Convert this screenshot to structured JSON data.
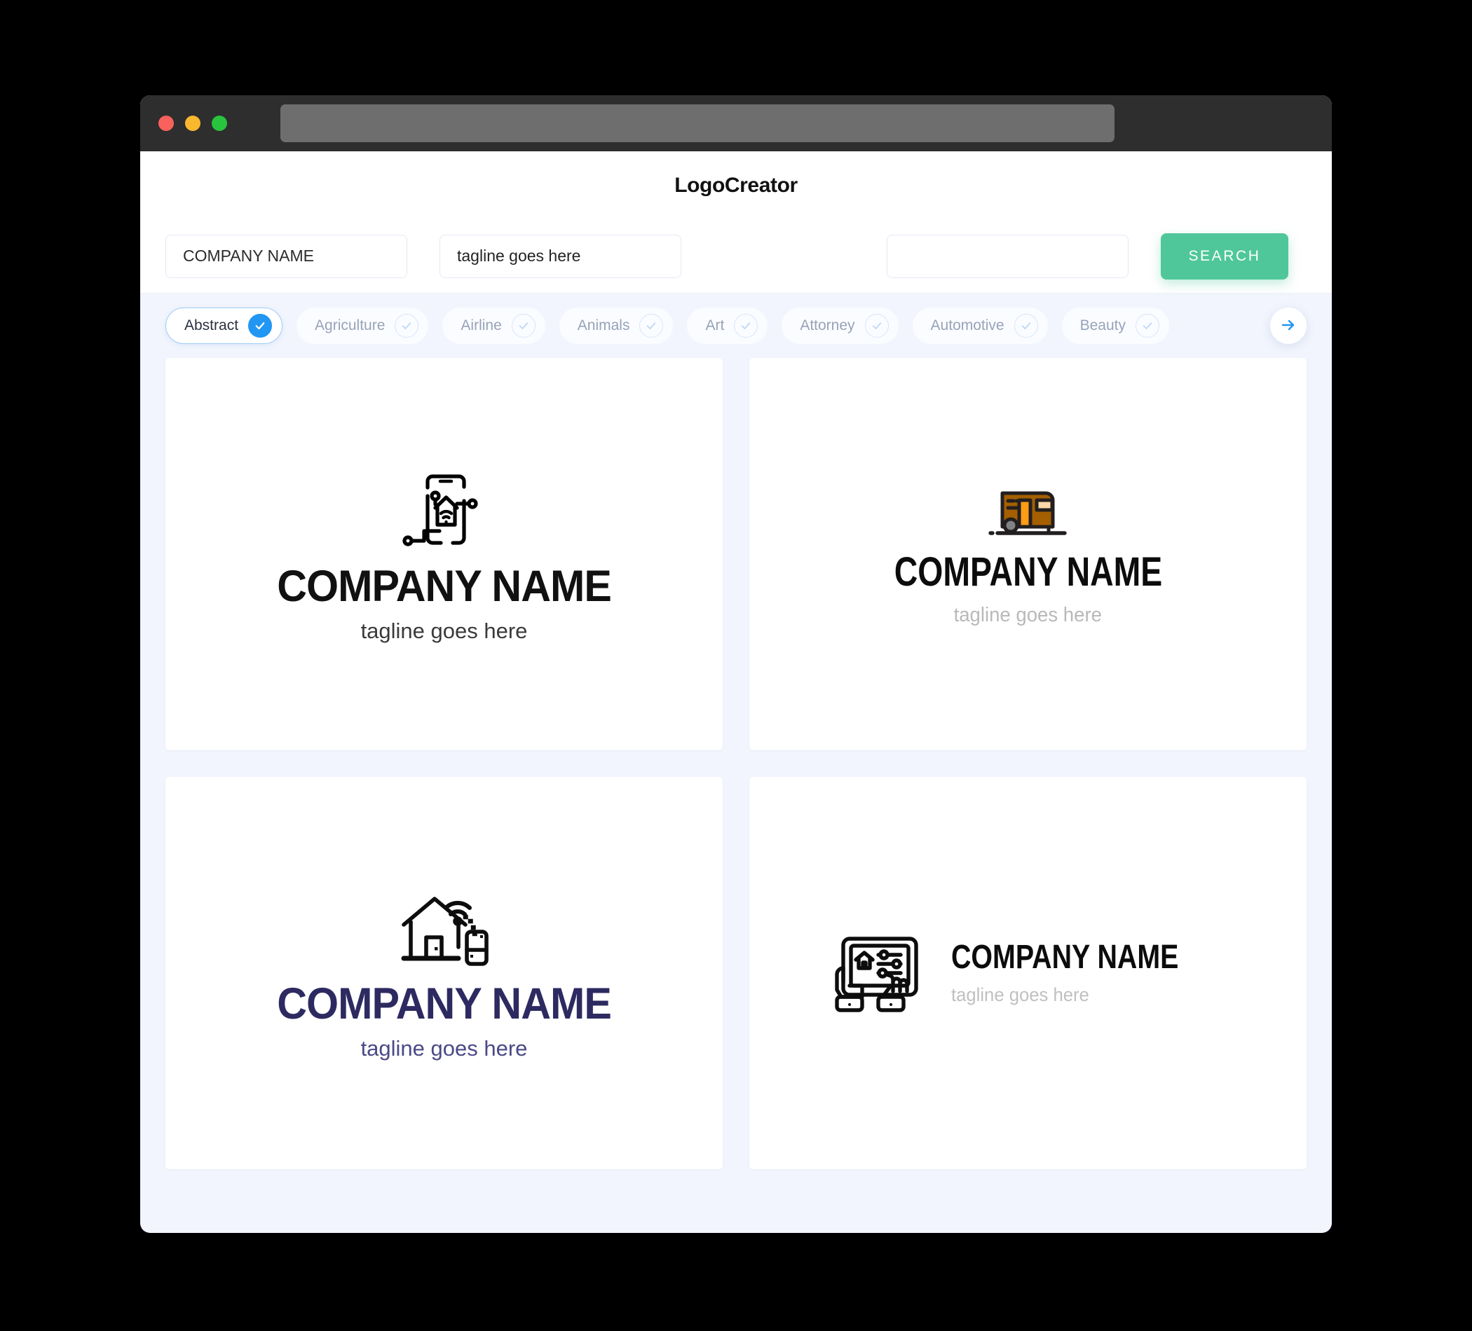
{
  "window": {
    "traffic_lights": [
      "close",
      "minimize",
      "maximize"
    ],
    "url_value": ""
  },
  "header": {
    "title": "LogoCreator"
  },
  "search": {
    "company_value": "COMPANY NAME",
    "tagline_value": "tagline goes here",
    "keyword_value": "",
    "keyword_placeholder": "",
    "button_label": "SEARCH",
    "button_color": "#4fc79b"
  },
  "categories": {
    "accent_color": "#2196f3",
    "items": [
      {
        "label": "Abstract",
        "selected": true
      },
      {
        "label": "Agriculture",
        "selected": false
      },
      {
        "label": "Airline",
        "selected": false
      },
      {
        "label": "Animals",
        "selected": false
      },
      {
        "label": "Art",
        "selected": false
      },
      {
        "label": "Attorney",
        "selected": false
      },
      {
        "label": "Automotive",
        "selected": false
      },
      {
        "label": "Beauty",
        "selected": false
      }
    ],
    "next_label": "next"
  },
  "results": {
    "cards": [
      {
        "icon": "smartphone-smart-home-wifi-icon",
        "name": "COMPANY NAME",
        "tagline": "tagline goes here",
        "name_color": "#111111",
        "tagline_color": "#3a3a3a",
        "layout": "stacked"
      },
      {
        "icon": "caravan-trailer-icon",
        "name": "COMPANY NAME",
        "tagline": "tagline goes here",
        "name_color": "#0c0c0c",
        "tagline_color": "#b9b9b9",
        "layout": "stacked"
      },
      {
        "icon": "house-wifi-phone-icon",
        "name": "COMPANY NAME",
        "tagline": "tagline goes here",
        "name_color": "#2d2a61",
        "tagline_color": "#4b4986",
        "layout": "stacked"
      },
      {
        "icon": "hands-tablet-home-controls-icon",
        "name": "COMPANY NAME",
        "tagline": "tagline goes here",
        "name_color": "#0c0c0c",
        "tagline_color": "#c0c0c0",
        "layout": "horizontal"
      }
    ]
  }
}
